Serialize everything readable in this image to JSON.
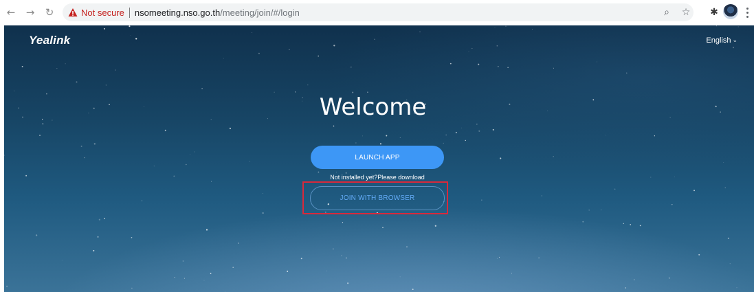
{
  "browser": {
    "security_label": "Not secure",
    "url_host": "nsomeeting.nso.go.th",
    "url_path": "/meeting/join/#/login",
    "icons": [
      "back-arrow-icon",
      "forward-arrow-icon",
      "reload-icon",
      "warning-icon",
      "zoom-icon",
      "bookmark-star-icon",
      "extension-puzzle-icon",
      "profile-avatar",
      "menu-kebab-icon"
    ]
  },
  "page": {
    "logo": "Yealink",
    "language": "English",
    "welcome": "Welcome",
    "launch_button": "LAUNCH APP",
    "download_link": "Not installed yet?Please download",
    "join_button": "JOIN WITH BROWSER",
    "colors": {
      "accent_blue": "#3d97f6",
      "join_text": "#63aaf5",
      "highlight_red": "#d9293b",
      "warning_red": "#c5221f"
    }
  }
}
